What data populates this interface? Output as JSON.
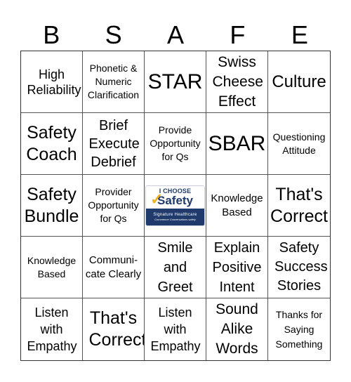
{
  "header": {
    "letters": [
      "B",
      "S",
      "A",
      "F",
      "E"
    ]
  },
  "cells": [
    {
      "text": "High Reliability"
    },
    {
      "text": "Phonetic & Numeric Clarification"
    },
    {
      "text": "STAR"
    },
    {
      "text": "Swiss Cheese Effect"
    },
    {
      "text": "Culture"
    },
    {
      "text": "Safety Coach"
    },
    {
      "text": "Brief Execute Debrief"
    },
    {
      "text": "Provide Opportunity for Qs"
    },
    {
      "text": "SBAR"
    },
    {
      "text": "Questioning Attitude"
    },
    {
      "text": "Safety Bundle"
    },
    {
      "text": "Provider Opportunity for Qs"
    },
    {
      "logo": {
        "line1": "I CHOOSE",
        "line2": "Safety",
        "org": "Signature Healthcare",
        "tagline": "Commence Conversations safely"
      }
    },
    {
      "text": "Knowledge Based"
    },
    {
      "text": "That's Correct"
    },
    {
      "text": "Knowledge Based"
    },
    {
      "text": "Communi- cate Clearly"
    },
    {
      "text": "Smile and Greet"
    },
    {
      "text": "Explain Positive Intent"
    },
    {
      "text": "Safety Success Stories"
    },
    {
      "text": "Listen with Empathy"
    },
    {
      "text": "That's Correct"
    },
    {
      "text": "Listen with Empathy"
    },
    {
      "text": "Sound Alike Words"
    },
    {
      "text": "Thanks for Saying Something"
    }
  ],
  "colors": {
    "logo_navy": "#1f3a6b",
    "logo_gold": "#f0b323"
  }
}
